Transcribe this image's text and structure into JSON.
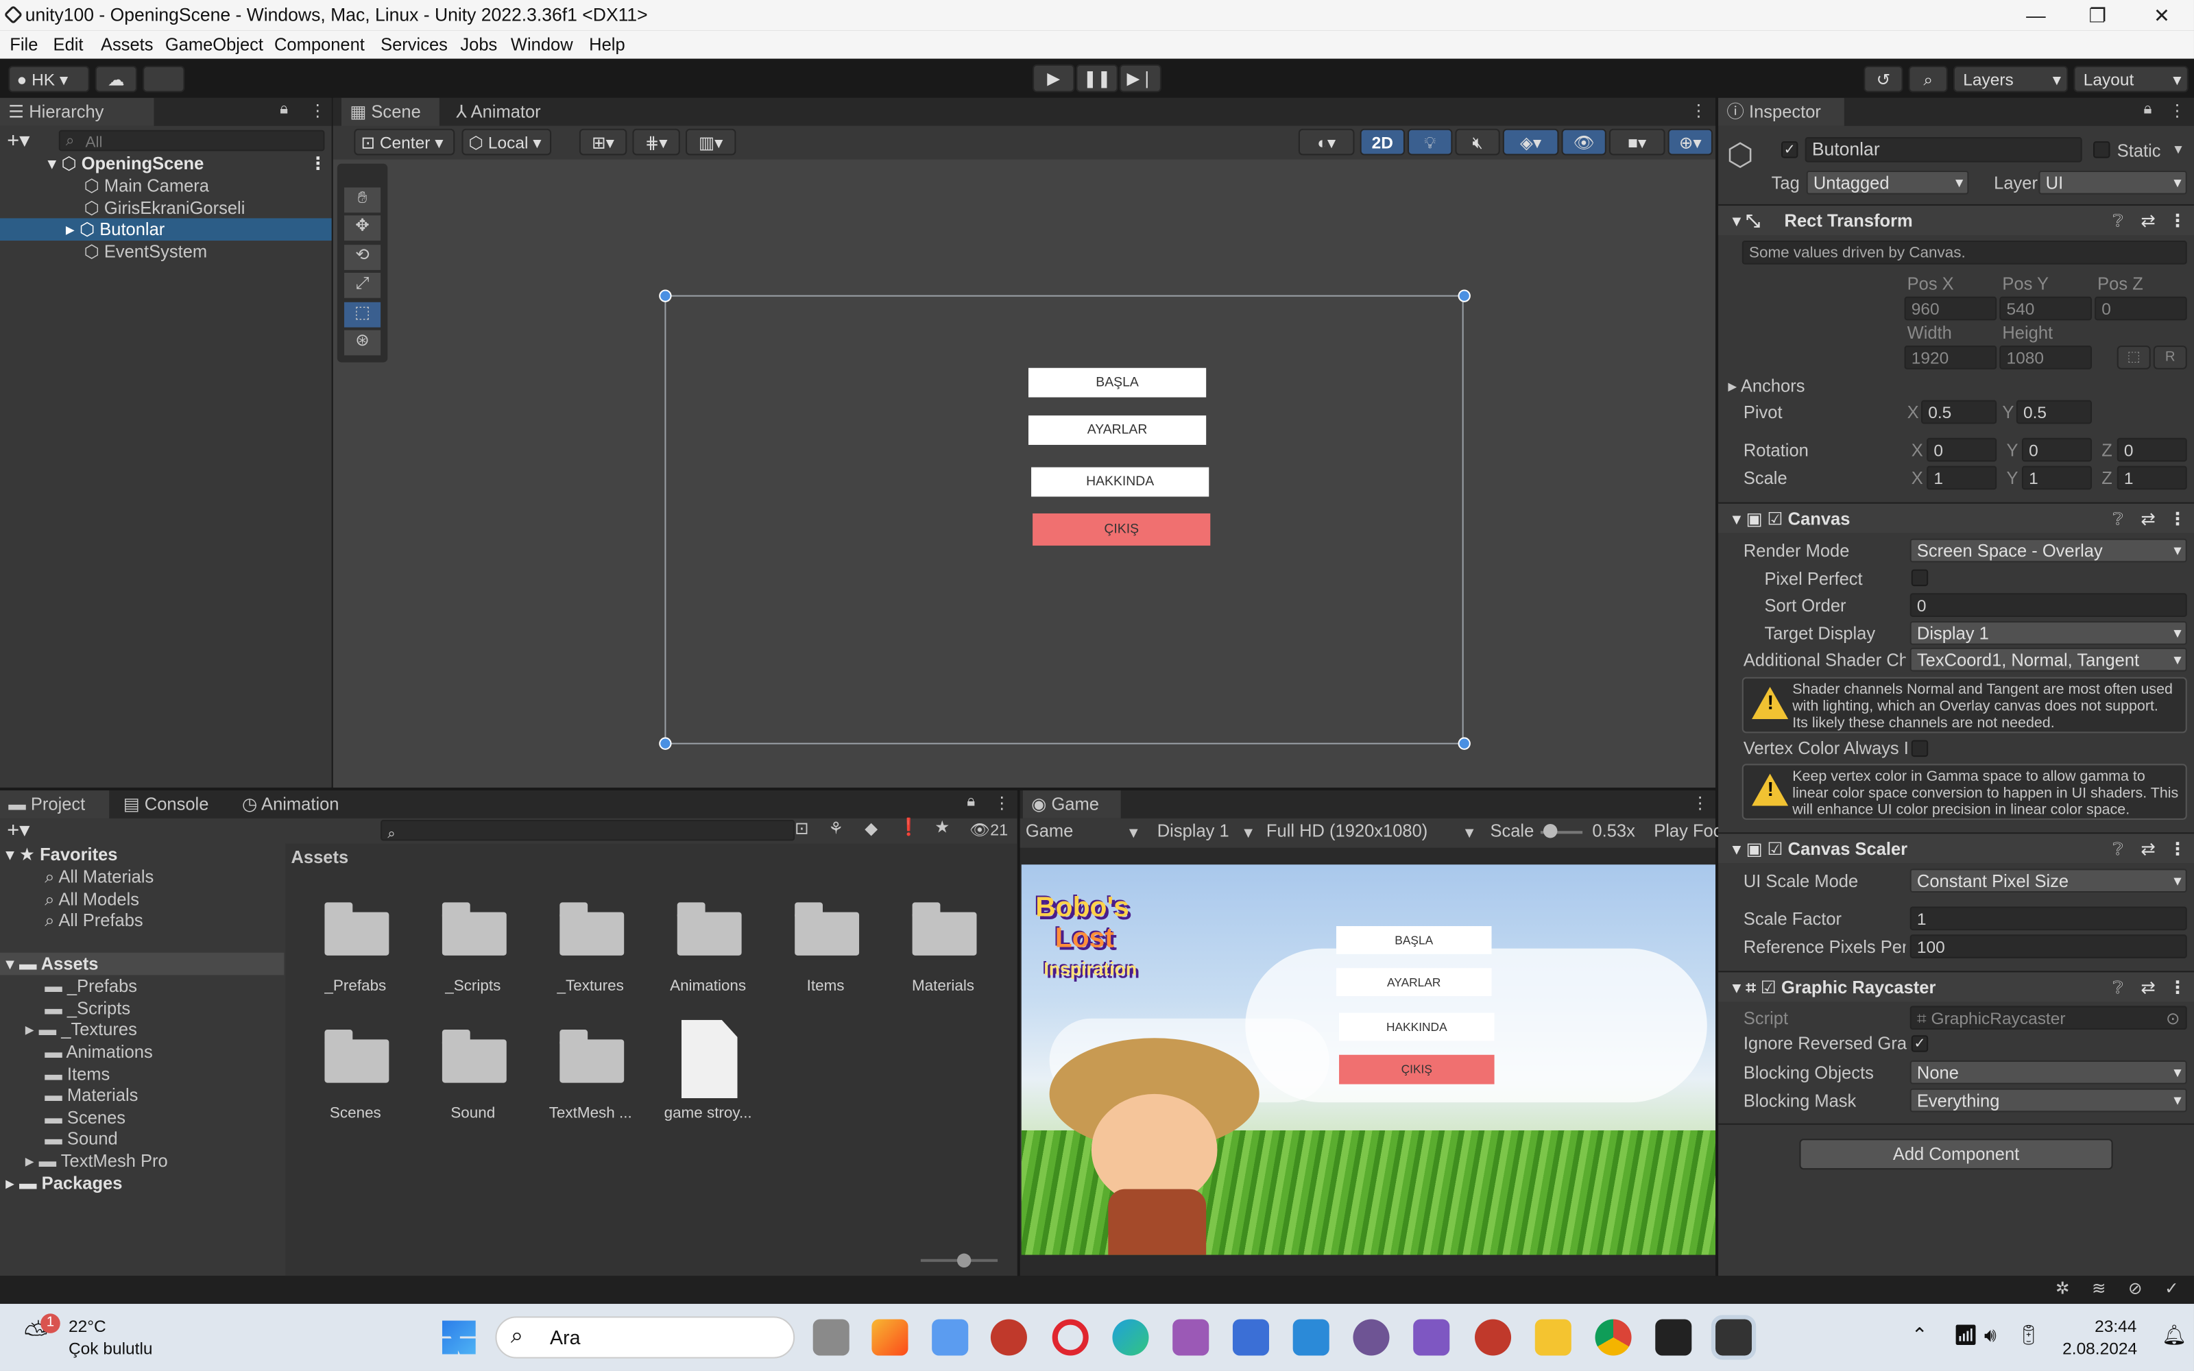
{
  "window": {
    "title": "unity100 - OpeningScene - Windows, Mac, Linux - Unity 2022.3.36f1 <DX11>"
  },
  "menu": [
    "File",
    "Edit",
    "Assets",
    "GameObject",
    "Component",
    "Services",
    "Jobs",
    "Window",
    "Help"
  ],
  "toolbar": {
    "account": "HK",
    "layers": "Layers",
    "layout": "Layout"
  },
  "hierarchy": {
    "tab": "Hierarchy",
    "search_placeholder": "All",
    "scene": "OpeningScene",
    "items": [
      "Main Camera",
      "GirisEkraniGorseli",
      "Butonlar",
      "EventSystem"
    ],
    "selected": "Butonlar"
  },
  "scene_view": {
    "tabs": [
      "Scene",
      "Animator"
    ],
    "pivot": "Center",
    "space": "Local",
    "mode2d": "2D",
    "buttons": [
      "BAŞLA",
      "AYARLAR",
      "HAKKINDA",
      "ÇIKIŞ"
    ]
  },
  "project": {
    "tabs": [
      "Project",
      "Console",
      "Animation"
    ],
    "favorites": "Favorites",
    "fav_items": [
      "All Materials",
      "All Models",
      "All Prefabs"
    ],
    "assets": "Assets",
    "asset_items": [
      "_Prefabs",
      "_Scripts",
      "_Textures",
      "Animations",
      "Items",
      "Materials",
      "Scenes",
      "Sound",
      "TextMesh Pro"
    ],
    "packages": "Packages",
    "hidden_count": "21",
    "grid": [
      "_Prefabs",
      "_Scripts",
      "_Textures",
      "Animations",
      "Items",
      "Materials",
      "Scenes",
      "Sound",
      "TextMesh ...",
      "game stroy..."
    ]
  },
  "game": {
    "tab": "Game",
    "view": "Game",
    "display": "Display 1",
    "resolution": "Full HD (1920x1080)",
    "scale_label": "Scale",
    "scale": "0.53x",
    "play": "Play Foc",
    "logo": [
      "Bobo's",
      "Lost",
      "Inspiration"
    ],
    "buttons": [
      "BAŞLA",
      "AYARLAR",
      "HAKKINDA",
      "ÇIKIŞ"
    ]
  },
  "inspector": {
    "tab": "Inspector",
    "name": "Butonlar",
    "static": "Static",
    "tag_label": "Tag",
    "tag": "Untagged",
    "layer_label": "Layer",
    "layer": "UI",
    "rect": {
      "title": "Rect Transform",
      "note": "Some values driven by Canvas.",
      "posx_l": "Pos X",
      "posy_l": "Pos Y",
      "posz_l": "Pos Z",
      "posx": "960",
      "posy": "540",
      "posz": "0",
      "w_l": "Width",
      "h_l": "Height",
      "w": "1920",
      "h": "1080",
      "r": "R",
      "anchors": "Anchors",
      "pivot": "Pivot",
      "pivx": "0.5",
      "pivy": "0.5",
      "rotation": "Rotation",
      "rx": "0",
      "ry": "0",
      "rz": "0",
      "scale": "Scale",
      "sx": "1",
      "sy": "1",
      "sz": "1",
      "x": "X",
      "y": "Y",
      "z": "Z"
    },
    "canvas": {
      "title": "Canvas",
      "render_mode_l": "Render Mode",
      "render_mode": "Screen Space - Overlay",
      "pixel_perfect": "Pixel Perfect",
      "sort_order_l": "Sort Order",
      "sort_order": "0",
      "target_display_l": "Target Display",
      "target_display": "Display 1",
      "shader_l": "Additional Shader Ch",
      "shader": "TexCoord1, Normal, Tangent",
      "warn1": [
        "Shader channels Normal and Tangent are most often used",
        "with lighting, which an Overlay canvas does not support.",
        "Its likely these channels are not needed."
      ],
      "vertex_l": "Vertex Color Always I",
      "warn2": [
        "Keep vertex color in Gamma space to allow gamma to",
        "linear color space conversion to happen in UI shaders. This",
        "will enhance UI color precision in linear color space."
      ]
    },
    "scaler": {
      "title": "Canvas Scaler",
      "mode_l": "UI Scale Mode",
      "mode": "Constant Pixel Size",
      "factor_l": "Scale Factor",
      "factor": "1",
      "ref_l": "Reference Pixels Per",
      "ref": "100"
    },
    "raycaster": {
      "title": "Graphic Raycaster",
      "script_l": "Script",
      "script": "GraphicRaycaster",
      "ignore_l": "Ignore Reversed Gra",
      "blocking_l": "Blocking Objects",
      "blocking": "None",
      "mask_l": "Blocking Mask",
      "mask": "Everything"
    },
    "add_component": "Add Component"
  },
  "taskbar": {
    "temp": "22°C",
    "weather": "Çok bulutlu",
    "badge": "1",
    "search": "Ara",
    "time": "23:44",
    "date": "2.08.2024"
  },
  "colors": {
    "selection": "#2c5d87",
    "exit_button": "#f07070",
    "unity_blue": "#4a90e2"
  }
}
